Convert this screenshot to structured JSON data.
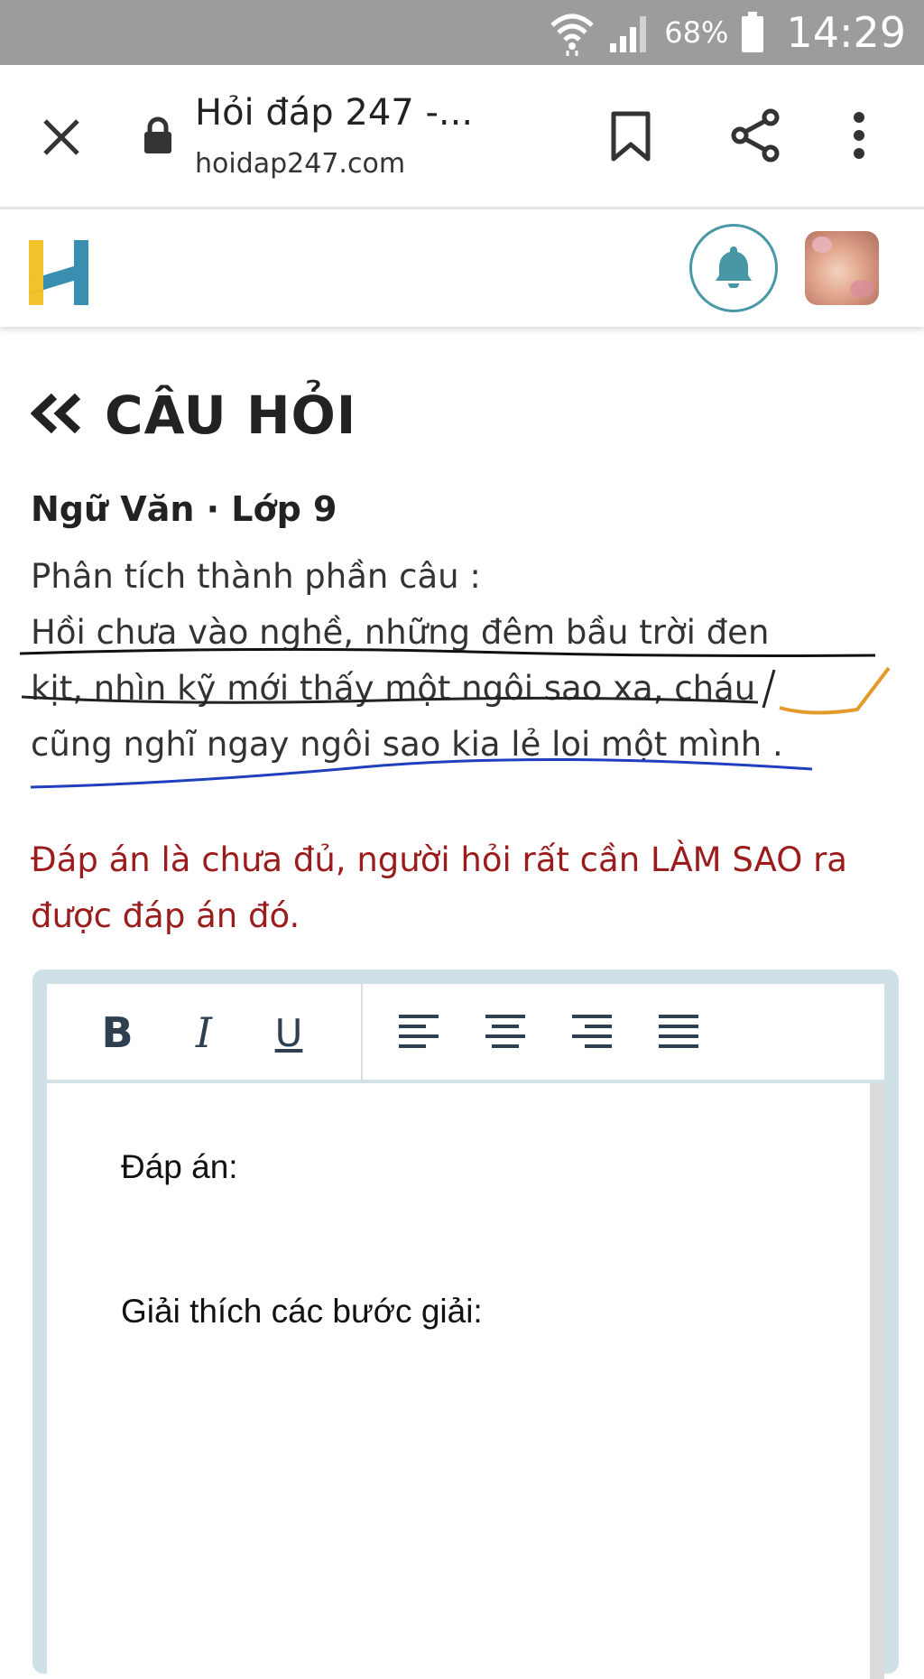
{
  "status_bar": {
    "battery_percent": "68%",
    "time": "14:29"
  },
  "browser": {
    "tab_title": "Hỏi đáp 247 -...",
    "url": "hoidap247.com",
    "icons": [
      "close-icon",
      "lock-icon",
      "bookmark-icon",
      "share-icon",
      "more-vert-icon"
    ]
  },
  "site_header": {
    "logo_letter": "H",
    "logo_colors": {
      "yellow": "#f2c22b",
      "blue": "#3a8fb0"
    },
    "bell_color": "#4797a6"
  },
  "page": {
    "heading": "CÂU HỎI",
    "subject": "Ngữ Văn · Lớp 9",
    "question_intro": "Phân tích thành phần câu :",
    "question_line1": "Hồi chưa vào nghề, những đêm bầu trời đen",
    "question_line2": "kịt,  nhìn kỹ mới thấy một ngôi sao xa, cháu",
    "question_line3": "cũng nghĩ ngay ngôi sao kia lẻ loi một mình .",
    "warning": "Đáp án là chưa đủ, người hỏi rất cần LÀM SAO ra được đáp án đó.",
    "warning_color": "#9b1c1c"
  },
  "editor": {
    "toolbar": [
      "bold",
      "italic",
      "underline",
      "align-left",
      "align-center",
      "align-right",
      "align-justify"
    ],
    "toolbar_labels": {
      "bold": "B",
      "italic": "I",
      "underline": "U"
    },
    "line1": "Đáp án:",
    "line2": "Giải thích các bước giải:"
  }
}
